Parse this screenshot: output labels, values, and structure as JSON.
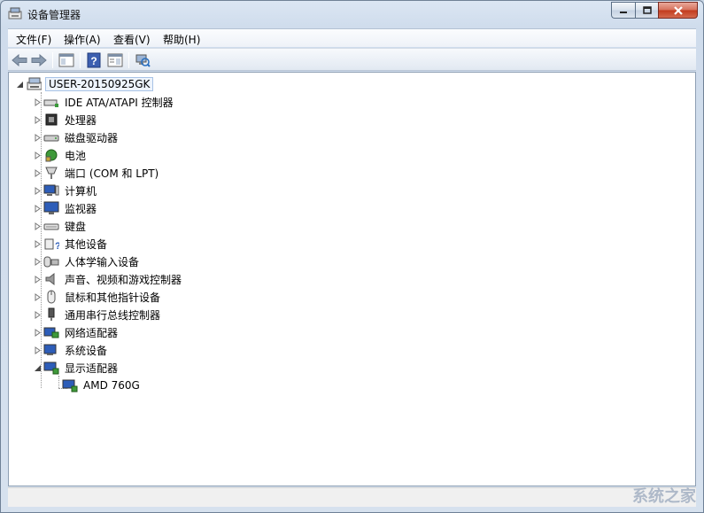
{
  "window": {
    "title": "设备管理器"
  },
  "menubar": {
    "items": [
      {
        "label": "文件(F)"
      },
      {
        "label": "操作(A)"
      },
      {
        "label": "查看(V)"
      },
      {
        "label": "帮助(H)"
      }
    ]
  },
  "toolbar": {
    "buttons": [
      {
        "icon": "back-arrow-icon"
      },
      {
        "icon": "forward-arrow-icon"
      },
      {
        "icon": "show-hide-console-tree-icon"
      },
      {
        "icon": "help-icon"
      },
      {
        "icon": "properties-icon"
      },
      {
        "icon": "scan-hardware-icon"
      }
    ]
  },
  "tree": {
    "root": {
      "label": "USER-20150925GK",
      "icon": "computer-icon",
      "expanded": true
    },
    "categories": [
      {
        "label": "IDE ATA/ATAPI 控制器",
        "icon": "ide-controller-icon",
        "expanded": false
      },
      {
        "label": "处理器",
        "icon": "processor-icon",
        "expanded": false
      },
      {
        "label": "磁盘驱动器",
        "icon": "disk-drive-icon",
        "expanded": false
      },
      {
        "label": "电池",
        "icon": "battery-icon",
        "expanded": false
      },
      {
        "label": "端口 (COM 和 LPT)",
        "icon": "port-icon",
        "expanded": false
      },
      {
        "label": "计算机",
        "icon": "computer-icon",
        "expanded": false
      },
      {
        "label": "监视器",
        "icon": "monitor-icon",
        "expanded": false
      },
      {
        "label": "键盘",
        "icon": "keyboard-icon",
        "expanded": false
      },
      {
        "label": "其他设备",
        "icon": "other-devices-icon",
        "expanded": false
      },
      {
        "label": "人体学输入设备",
        "icon": "hid-icon",
        "expanded": false
      },
      {
        "label": "声音、视频和游戏控制器",
        "icon": "speaker-icon",
        "expanded": false
      },
      {
        "label": "鼠标和其他指针设备",
        "icon": "mouse-icon",
        "expanded": false
      },
      {
        "label": "通用串行总线控制器",
        "icon": "usb-icon",
        "expanded": false
      },
      {
        "label": "网络适配器",
        "icon": "network-adapter-icon",
        "expanded": false
      },
      {
        "label": "系统设备",
        "icon": "system-device-icon",
        "expanded": false
      },
      {
        "label": "显示适配器",
        "icon": "display-adapter-icon",
        "expanded": true
      }
    ],
    "display_adapter_children": [
      {
        "label": "AMD 760G",
        "icon": "display-adapter-icon"
      }
    ]
  },
  "watermark": {
    "text": "系统之家"
  },
  "colors": {
    "titlebar": "#dbe6f3",
    "close_button": "#c23a1c",
    "tree_background": "#ffffff",
    "root_selection": "#eef4fc"
  }
}
